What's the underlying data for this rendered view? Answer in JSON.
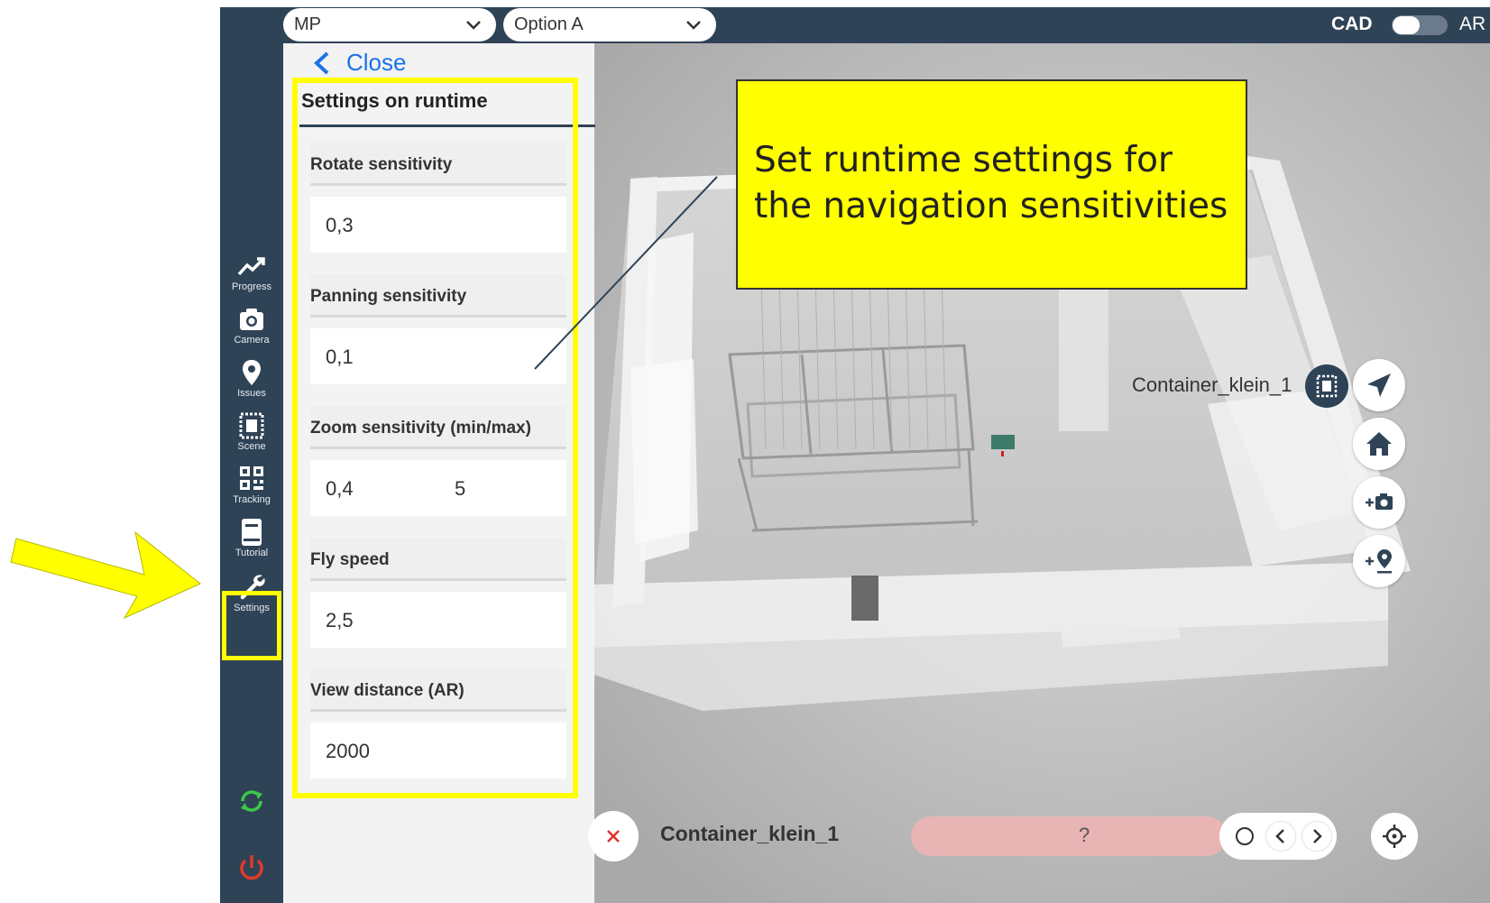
{
  "topbar": {
    "project_dropdown": "MP",
    "option_dropdown": "Option A",
    "mode_left": "CAD",
    "mode_right": "AR",
    "mode_toggle_on": false
  },
  "sidebar": {
    "items": [
      {
        "label": "Progress",
        "icon": "trend-icon"
      },
      {
        "label": "Camera",
        "icon": "camera-icon"
      },
      {
        "label": "Issues",
        "icon": "map-pin-icon"
      },
      {
        "label": "Scene",
        "icon": "scene-icon"
      },
      {
        "label": "Tracking",
        "icon": "qr-code-icon"
      },
      {
        "label": "Tutorial",
        "icon": "book-icon"
      },
      {
        "label": "Settings",
        "icon": "wrench-icon"
      }
    ],
    "sync_icon": "sync-icon",
    "power_icon": "power-icon"
  },
  "panel": {
    "close_label": "Close",
    "title": "Settings on runtime",
    "fields": [
      {
        "label": "Rotate sensitivity",
        "value": "0,3"
      },
      {
        "label": "Panning sensitivity",
        "value": "0,1"
      },
      {
        "label": "Zoom sensitivity (min/max)",
        "value": "0,4",
        "value_max": "5"
      },
      {
        "label": "Fly speed",
        "value": "2,5"
      },
      {
        "label": "View distance (AR)",
        "value": "2000"
      }
    ]
  },
  "viewport": {
    "selected_object": "Container_klein_1",
    "right_buttons": [
      "send-icon",
      "home-icon",
      "add-photo-icon",
      "add-pin-icon"
    ]
  },
  "bottombar": {
    "object_name": "Container_klein_1",
    "status": "?"
  },
  "callout": {
    "text": "Set runtime settings for the navigation sensitivities"
  },
  "colors": {
    "sidebar_bg": "#2f4356",
    "highlight": "#ffff00",
    "link": "#1a73e8",
    "status_pill": "#e8b4b4"
  }
}
